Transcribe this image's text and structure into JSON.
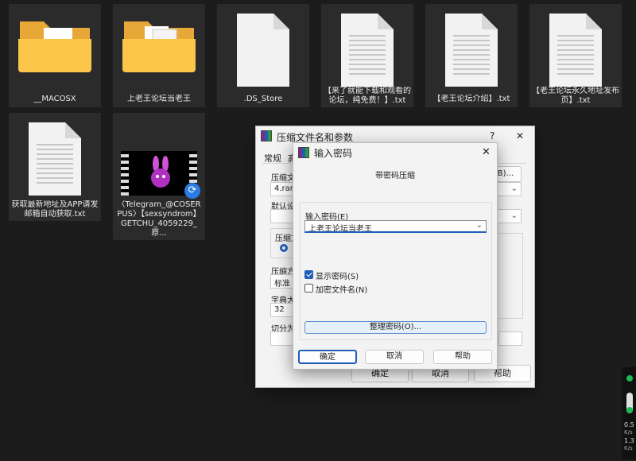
{
  "desktop": {
    "files": [
      {
        "name": "__MACOSX",
        "type": "folder"
      },
      {
        "name": "上老王论坛当老王",
        "type": "folder"
      },
      {
        "name": ".DS_Store",
        "type": "blank"
      },
      {
        "name": "【来了就能下载和观看的论坛，纯免费！】.txt",
        "type": "text"
      },
      {
        "name": "【老王论坛介绍】.txt",
        "type": "text"
      },
      {
        "name": "【老王论坛永久地址发布页】.txt",
        "type": "text"
      },
      {
        "name": "获取最新地址及APP请发邮箱自动获取.txt",
        "type": "text"
      },
      {
        "name": "〈Telegram_@COSERPUS〉【sexsyndrom】GETCHU_4059229_原...",
        "type": "video"
      }
    ]
  },
  "archive_dialog": {
    "title": "压缩文件名和参数",
    "help_glyph": "?",
    "close_glyph": "✕",
    "tabs": [
      "常规",
      "高"
    ],
    "archive_name_label": "压缩文件",
    "archive_name_value": "4.rar",
    "browse_label": "(B)...",
    "default_settings_label": "默认设置",
    "format_label": "压缩文",
    "method_label": "压缩方",
    "method_value": "标准",
    "dict_label": "字典大小",
    "dict_value": "32",
    "split_label": "切分为分",
    "ok_label": "确定",
    "cancel_label": "取消",
    "help_label": "帮助"
  },
  "password_dialog": {
    "title": "输入密码",
    "close_glyph": "✕",
    "heading": "带密码压缩",
    "password_label": "输入密码(E)",
    "password_value": "上老王论坛当老王",
    "show_password_label": "显示密码(S)",
    "show_password_checked": true,
    "encrypt_names_label": "加密文件名(N)",
    "encrypt_names_checked": false,
    "organize_label": "整理密码(O)...",
    "ok_label": "确定",
    "cancel_label": "取消",
    "help_label": "帮助"
  },
  "network_widget": {
    "upload": "0.5",
    "download": "1.3",
    "unit": "K/s",
    "status_color": "#1db954"
  }
}
